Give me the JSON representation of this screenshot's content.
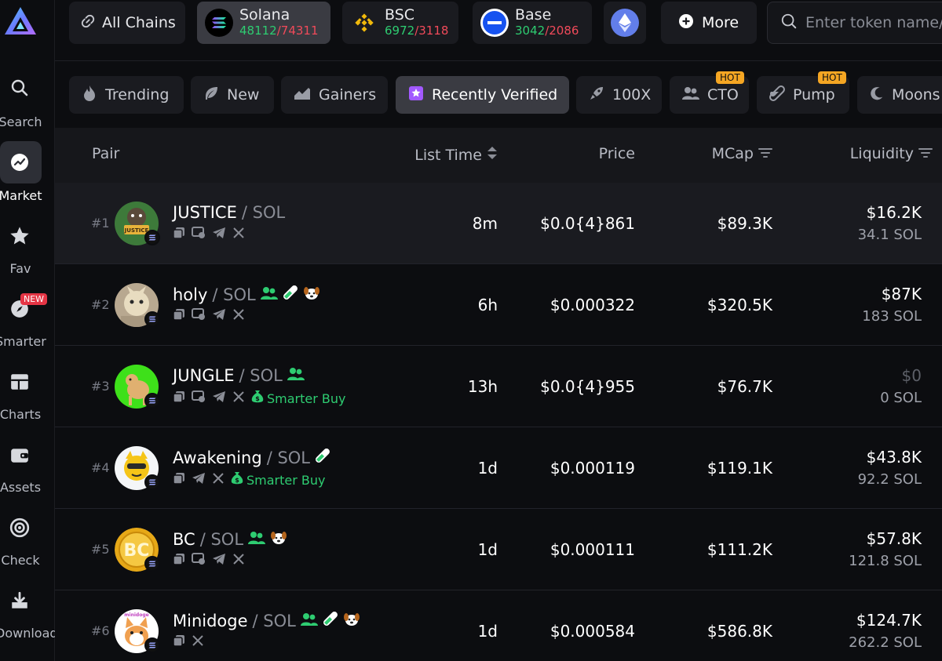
{
  "sidebar": {
    "items": [
      {
        "label": "Search",
        "icon": "search-icon"
      },
      {
        "label": "Market",
        "icon": "market-icon",
        "active": true
      },
      {
        "label": "Fav",
        "icon": "star-icon"
      },
      {
        "label": "Smarter",
        "icon": "compass-icon",
        "badge": "NEW"
      },
      {
        "label": "Charts",
        "icon": "charts-icon"
      },
      {
        "label": "Assets",
        "icon": "wallet-icon"
      },
      {
        "label": "Check",
        "icon": "target-icon"
      },
      {
        "label": "Download",
        "icon": "download-icon"
      }
    ]
  },
  "chains": {
    "all_label": "All Chains",
    "items": [
      {
        "name": "Solana",
        "up": "48112",
        "down": "74311"
      },
      {
        "name": "BSC",
        "up": "6972",
        "down": "3118"
      },
      {
        "name": "Base",
        "up": "3042",
        "down": "2086"
      }
    ],
    "more_label": "More"
  },
  "search": {
    "placeholder": "Enter token name/"
  },
  "tabs": [
    {
      "label": "Trending",
      "icon": "fire-icon"
    },
    {
      "label": "New",
      "icon": "leaf-icon"
    },
    {
      "label": "Gainers",
      "icon": "chart-up-icon"
    },
    {
      "label": "Recently Verified",
      "icon": "verified-icon",
      "active": true
    },
    {
      "label": "100X",
      "icon": "rocket-icon"
    },
    {
      "label": "CTO",
      "icon": "users-icon",
      "badge": "HOT"
    },
    {
      "label": "Pump",
      "icon": "pill-icon",
      "badge": "HOT"
    },
    {
      "label": "Moons",
      "icon": "moon-icon"
    }
  ],
  "table": {
    "headers": {
      "pair": "Pair",
      "list_time": "List Time",
      "price": "Price",
      "mcap": "MCap",
      "liquidity": "Liquidity"
    },
    "quote": "/ SOL",
    "smarter_label": "Smarter Buy",
    "rows": [
      {
        "rank": "#1",
        "name": "JUSTICE",
        "list_time": "8m",
        "price": "$0.0{4}861",
        "mcap": "$89.3K",
        "liq_usd": "$16.2K",
        "liq_sol": "34.1 SOL",
        "avatar_text": "JUSTICE"
      },
      {
        "rank": "#2",
        "name": "holy",
        "list_time": "6h",
        "price": "$0.000322",
        "mcap": "$320.5K",
        "liq_usd": "$87K",
        "liq_sol": "183 SOL",
        "avatar_text": ""
      },
      {
        "rank": "#3",
        "name": "JUNGLE",
        "list_time": "13h",
        "price": "$0.0{4}955",
        "mcap": "$76.7K",
        "liq_usd": "$0",
        "liq_sol": "0 SOL",
        "avatar_text": ""
      },
      {
        "rank": "#4",
        "name": "Awakening",
        "list_time": "1d",
        "price": "$0.000119",
        "mcap": "$119.1K",
        "liq_usd": "$43.8K",
        "liq_sol": "92.2 SOL",
        "avatar_text": ""
      },
      {
        "rank": "#5",
        "name": "BC",
        "list_time": "1d",
        "price": "$0.000111",
        "mcap": "$111.2K",
        "liq_usd": "$57.8K",
        "liq_sol": "121.8 SOL",
        "avatar_text": "BC"
      },
      {
        "rank": "#6",
        "name": "Minidoge",
        "list_time": "1d",
        "price": "$0.000584",
        "mcap": "$586.8K",
        "liq_usd": "$124.7K",
        "liq_sol": "262.2 SOL",
        "avatar_text": "minidoge"
      }
    ]
  },
  "colors": {
    "up": "#2ecc71",
    "down": "#f04a5a",
    "hot": "#f5a623",
    "accent": "#a259ff"
  }
}
